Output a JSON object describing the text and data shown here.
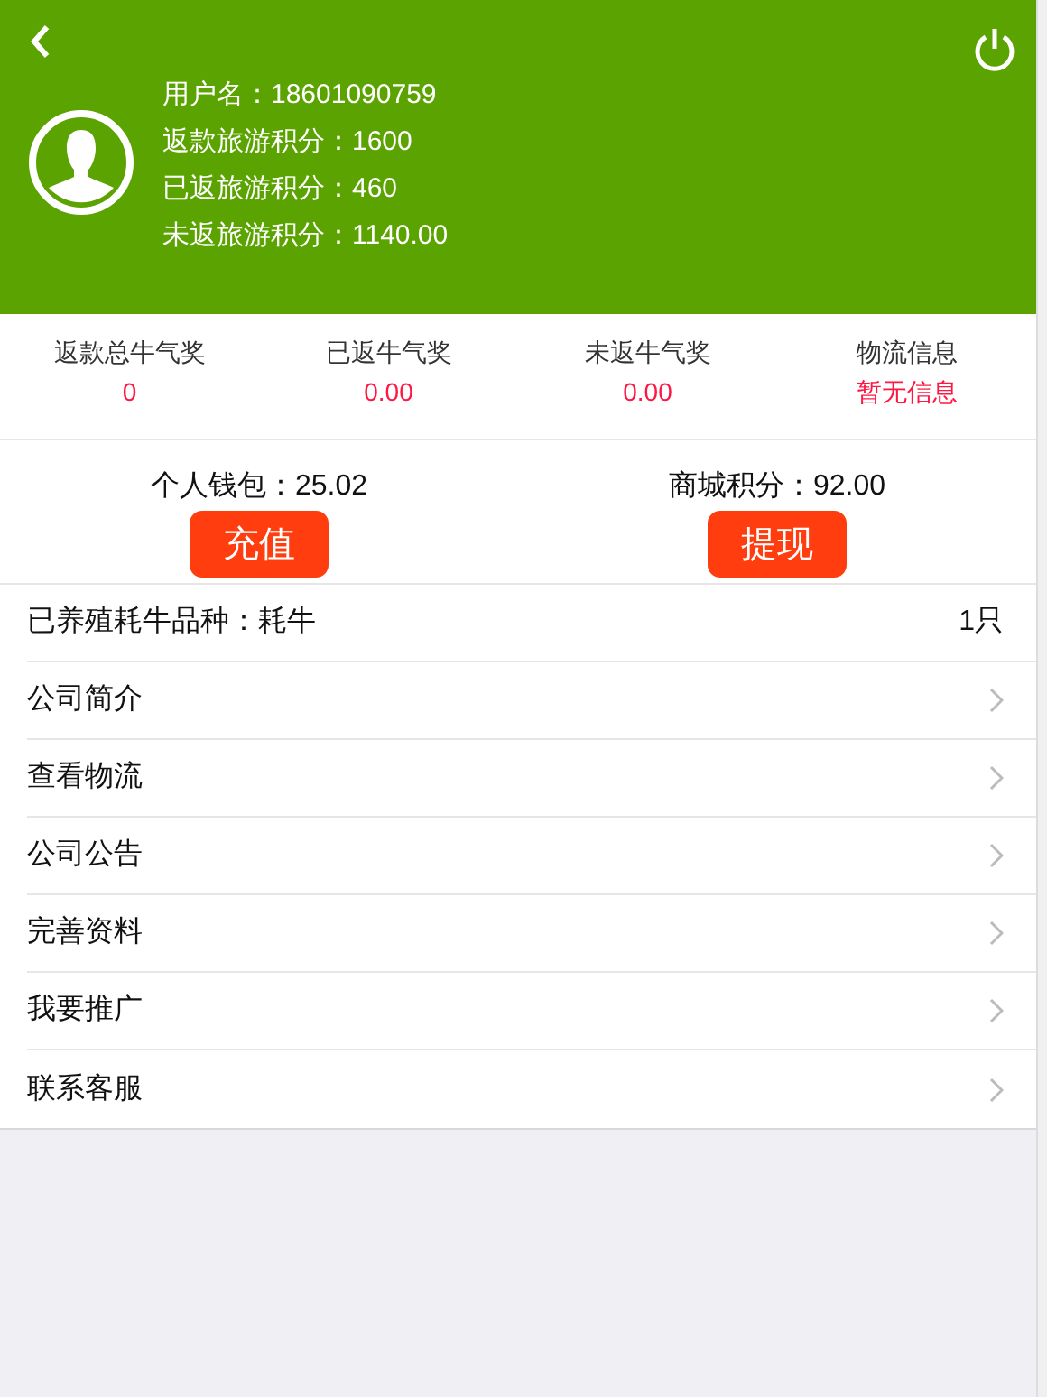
{
  "header": {
    "info": [
      {
        "label": "用户名：",
        "value": "18601090759"
      },
      {
        "label": "返款旅游积分：",
        "value": "1600"
      },
      {
        "label": "已返旅游积分：",
        "value": "460"
      },
      {
        "label": "未返旅游积分：",
        "value": "1140.00"
      }
    ]
  },
  "stats": [
    {
      "label": "返款总牛气奖",
      "value": "0"
    },
    {
      "label": "已返牛气奖",
      "value": "0.00"
    },
    {
      "label": "未返牛气奖",
      "value": "0.00"
    },
    {
      "label": "物流信息",
      "value": "暂无信息"
    }
  ],
  "wallets": [
    {
      "label": "个人钱包：",
      "value": "25.02",
      "button": "充值"
    },
    {
      "label": "商城积分：",
      "value": "92.00",
      "button": "提现"
    }
  ],
  "menu": [
    {
      "kind": "info",
      "label": "已养殖耗牛品种：耗牛",
      "value": "1只"
    },
    {
      "kind": "link",
      "label": "公司简介"
    },
    {
      "kind": "link",
      "label": "查看物流"
    },
    {
      "kind": "link",
      "label": "公司公告"
    },
    {
      "kind": "link",
      "label": "完善资料"
    },
    {
      "kind": "link",
      "label": "我要推广"
    },
    {
      "kind": "link",
      "label": "联系客服"
    }
  ]
}
